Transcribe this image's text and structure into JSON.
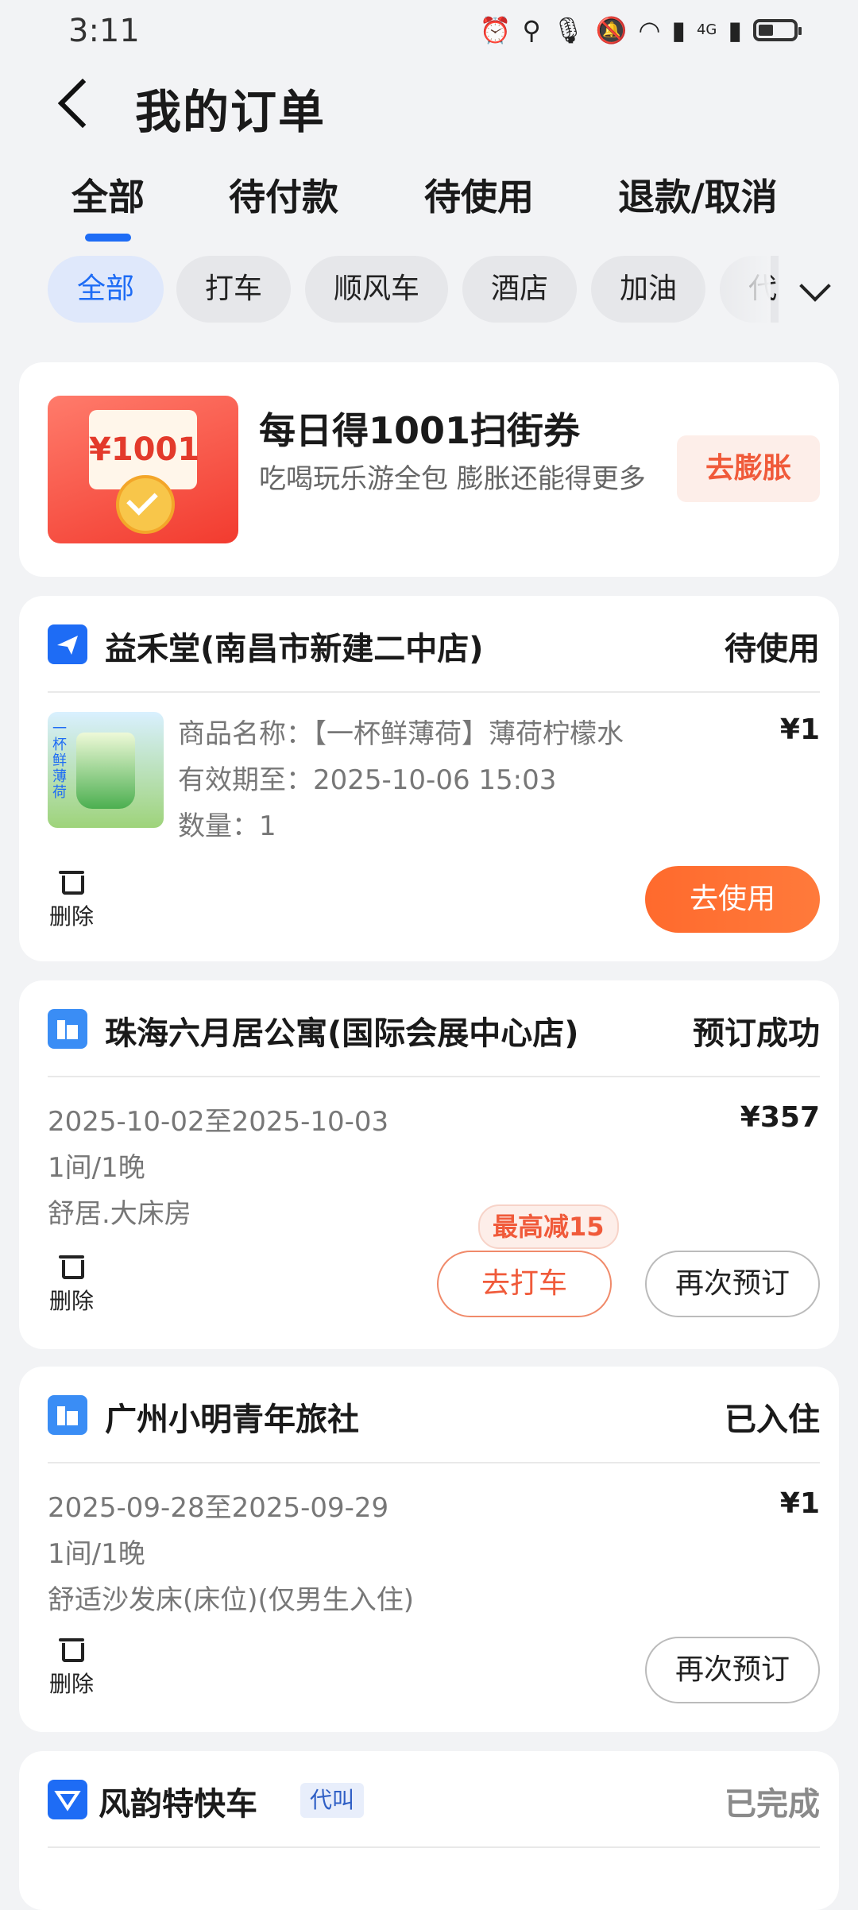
{
  "status_bar": {
    "time": "3:11",
    "icons": [
      "alarm-icon",
      "location-icon",
      "mic-icon",
      "bell-off-icon",
      "wifi-icon",
      "signal-icon",
      "4g-signal-icon",
      "battery-icon"
    ],
    "network_label": "4G"
  },
  "header": {
    "title": "我的订单"
  },
  "tabs": [
    {
      "label": "全部",
      "active": true
    },
    {
      "label": "待付款",
      "active": false
    },
    {
      "label": "待使用",
      "active": false
    },
    {
      "label": "退款/取消",
      "active": false
    }
  ],
  "filters": [
    {
      "label": "全部",
      "active": true
    },
    {
      "label": "打车",
      "active": false
    },
    {
      "label": "顺风车",
      "active": false
    },
    {
      "label": "酒店",
      "active": false
    },
    {
      "label": "加油",
      "active": false
    },
    {
      "label": "代",
      "active": false
    }
  ],
  "promo": {
    "image_text": "¥1001",
    "title": "每日得1001扫街券",
    "subtitle": "吃喝玩乐游全包 膨胀还能得更多",
    "button": "去膨胀"
  },
  "orders": [
    {
      "store": "益禾堂(南昌市新建二中店)",
      "status": "待使用",
      "thumb_text": "一杯鲜薄荷",
      "product": "商品名称：【一杯鲜薄荷】薄荷柠檬水",
      "valid_until": "有效期至：2025-10-06 15:03",
      "quantity": "数量：1",
      "price": "¥1",
      "delete_label": "删除",
      "primary_button": "去使用"
    },
    {
      "store": "珠海六月居公寓(国际会展中心店)",
      "status": "预订成功",
      "dates": "2025-10-02至2025-10-03",
      "rooms": "1间/1晚",
      "room_type": "舒居.大床房",
      "price": "¥357",
      "delete_label": "删除",
      "promo_tag": "最高减15",
      "taxi_button": "去打车",
      "rebook_button": "再次预订"
    },
    {
      "store": "广州小明青年旅社",
      "status": "已入住",
      "dates": "2025-09-28至2025-09-29",
      "rooms": "1间/1晚",
      "room_type": "舒适沙发床(床位)(仅男生入住)",
      "price": "¥1",
      "delete_label": "删除",
      "rebook_button": "再次预订"
    },
    {
      "store": "风韵特快车",
      "badge": "代叫",
      "status": "已完成"
    }
  ],
  "colors": {
    "accent": "#1e6cf5",
    "orange": "#ff6a2d",
    "background": "#f2f3f5"
  }
}
